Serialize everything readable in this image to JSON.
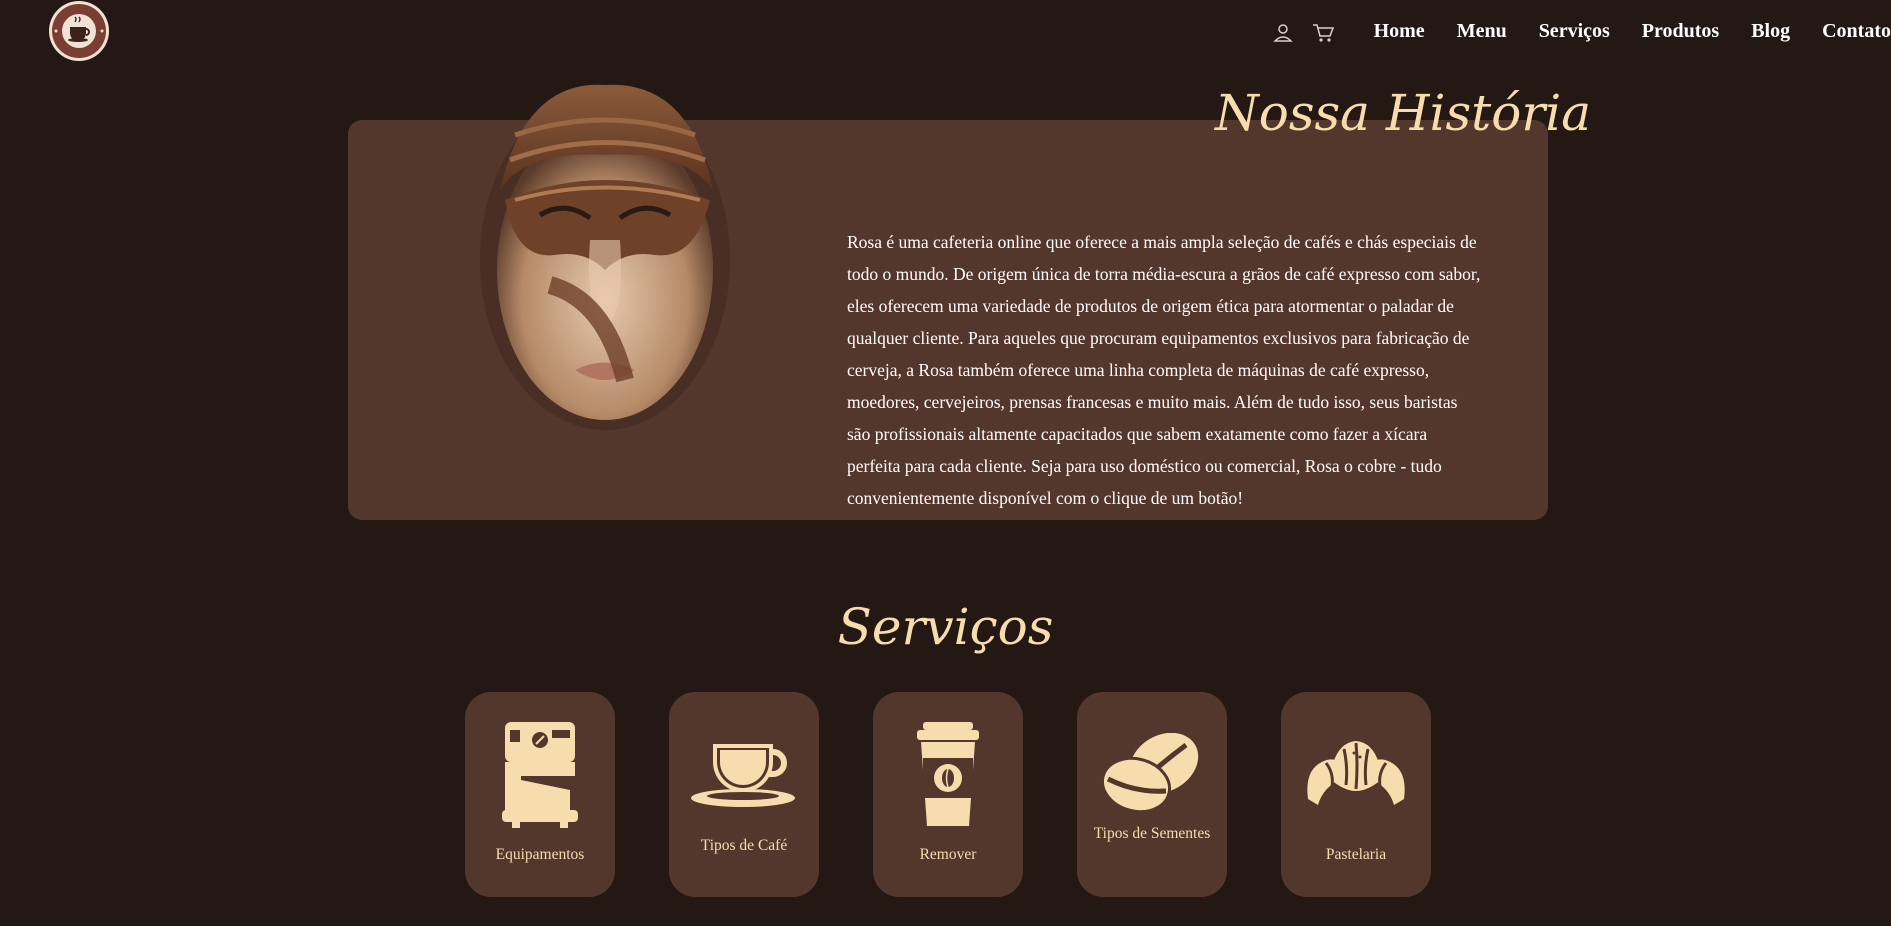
{
  "header": {
    "logo_alt": "COFFEE HOUSE",
    "nav": [
      "Home",
      "Menu",
      "Serviços",
      "Produtos",
      "Blog",
      "Contato"
    ],
    "icons": [
      "user-icon",
      "cart-icon"
    ]
  },
  "history": {
    "title": "Nossa História",
    "text": "Rosa é uma cafeteria online que oferece a mais ampla seleção de cafés e chás especiais de todo o mundo. De origem única de torra média-escura a grãos de café expresso com sabor, eles oferecem uma variedade de produtos de origem ética para atormentar o paladar de qualquer cliente. Para aqueles que procuram equipamentos exclusivos para fabricação de cerveja, a Rosa também oferece uma linha completa de máquinas de café expresso, moedores, cervejeiros, prensas francesas e muito mais. Além de tudo isso, seus baristas são profissionais altamente capacitados que sabem exatamente como fazer a xícara perfeita para cada cliente. Seja para uso doméstico ou comercial, Rosa o cobre - tudo convenientemente disponível com o clique de um botão!"
  },
  "services": {
    "title": "Serviços",
    "items": [
      {
        "label": "Equipamentos",
        "icon": "espresso-machine-icon"
      },
      {
        "label": "Tipos de Café",
        "icon": "coffee-cup-icon"
      },
      {
        "label": "Remover",
        "icon": "takeaway-cup-icon"
      },
      {
        "label": "Tipos de Sementes",
        "icon": "coffee-beans-icon"
      },
      {
        "label": "Pastelaria",
        "icon": "croissant-icon"
      }
    ]
  },
  "colors": {
    "background": "#231814",
    "card": "#54372c",
    "accent": "#f7dcae"
  }
}
